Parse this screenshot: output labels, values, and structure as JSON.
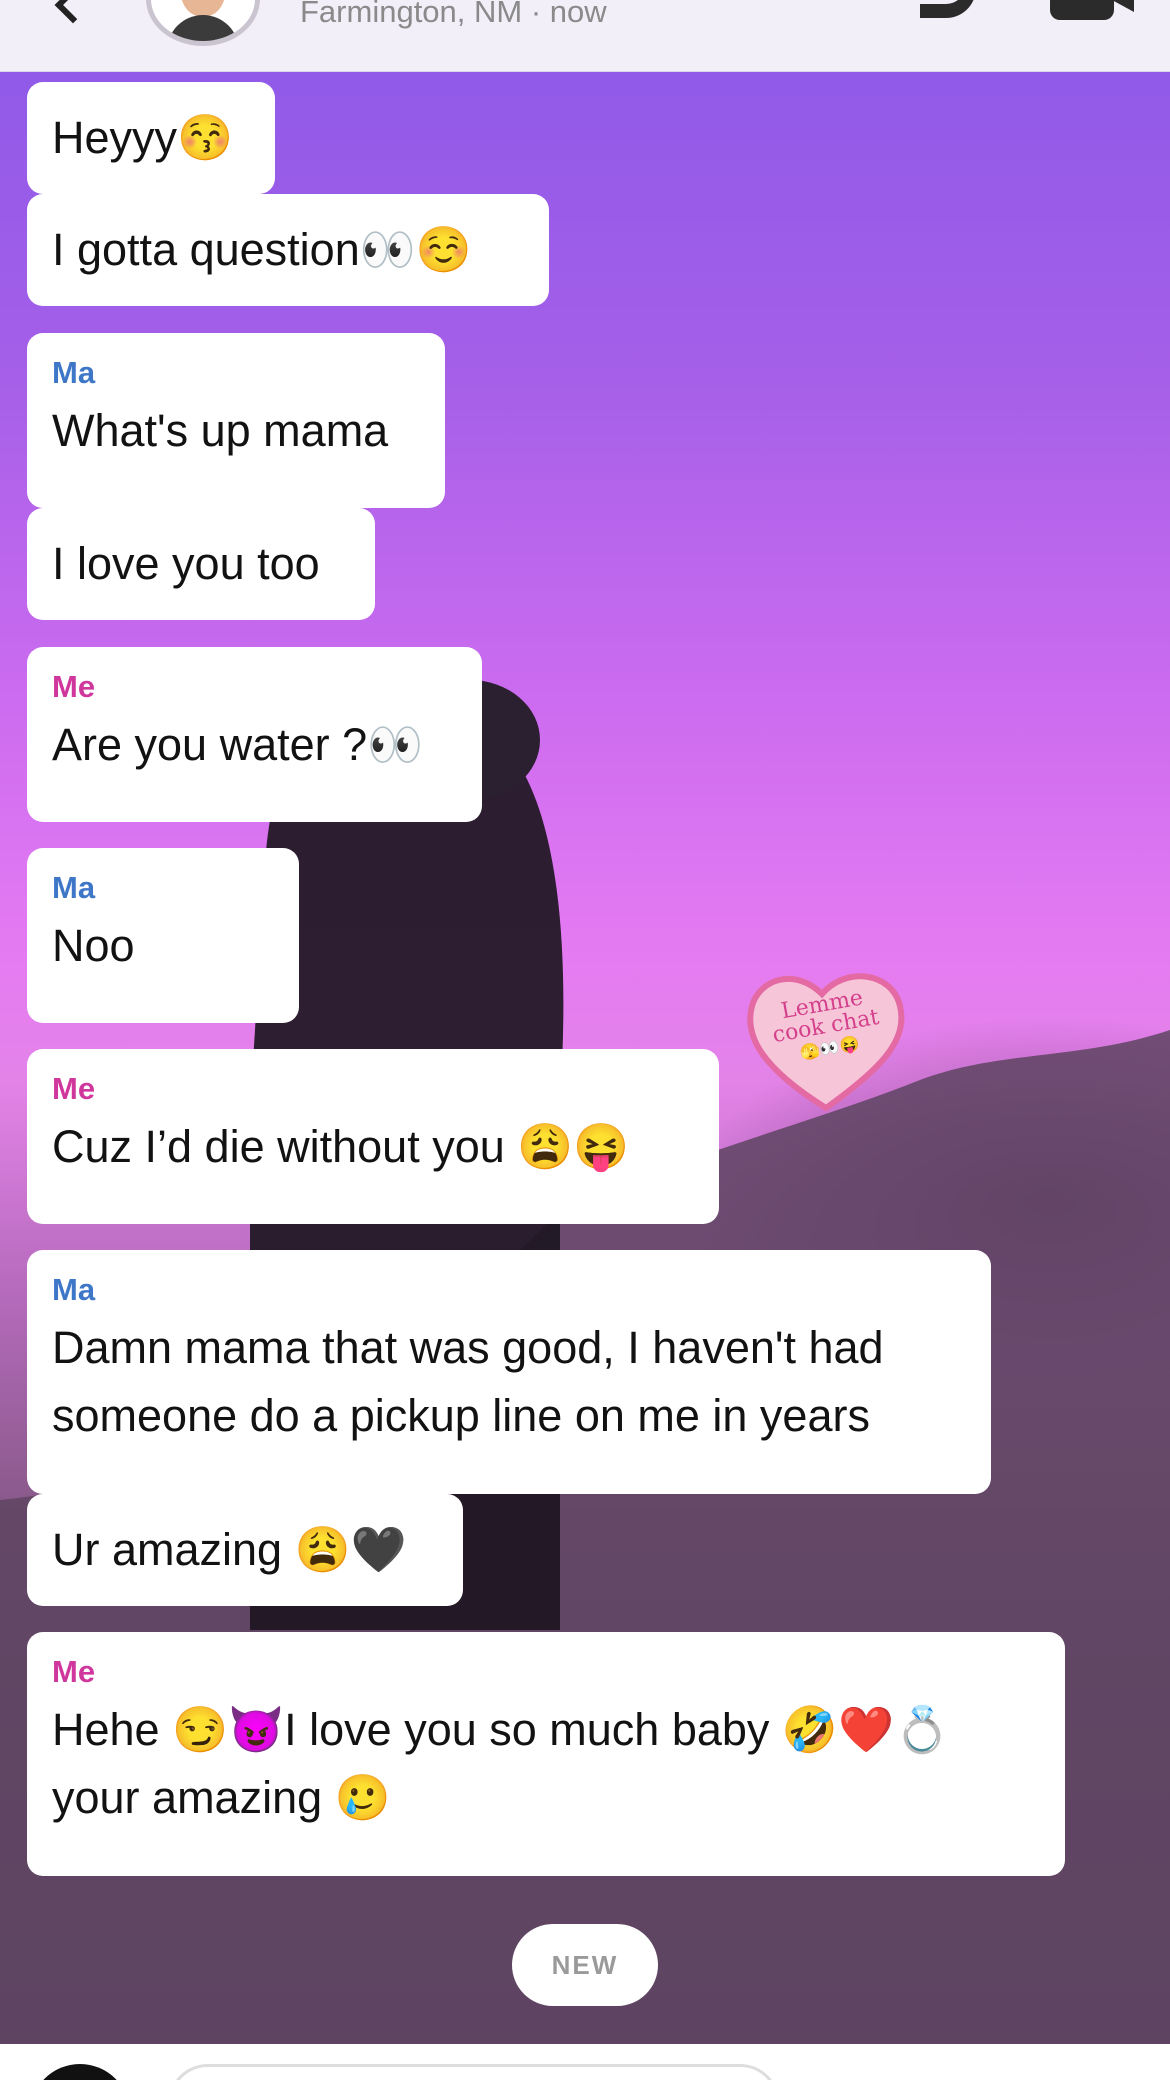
{
  "header": {
    "subtitle": "Farmington, NM · now"
  },
  "messages": [
    {
      "sender": "",
      "text": "Heyyy😚"
    },
    {
      "sender": "",
      "text": "I gotta question👀☺️"
    },
    {
      "sender": "Ma",
      "text": "What's up mama"
    },
    {
      "sender": "",
      "text": "I love you too"
    },
    {
      "sender": "Me",
      "text": "Are you water ?👀"
    },
    {
      "sender": "Ma",
      "text": "Noo"
    },
    {
      "sender": "Me",
      "text": "Cuz I’d die without you 😩😝"
    },
    {
      "sender": "Ma",
      "text": "Damn mama that was good, I haven't had someone do a pickup line on me in years"
    },
    {
      "sender": "",
      "text": "Ur amazing 😩🖤"
    },
    {
      "sender": "Me",
      "text": "Hehe 😏😈I love you so much baby 🤣❤️💍 your amazing 🥲"
    }
  ],
  "sticker": {
    "line1": "Lemme",
    "line2": "cook chat",
    "line3": "🫣👀😝"
  },
  "new_label": "NEW",
  "colors": {
    "ma_accent": "#3f77c8",
    "me_accent": "#d0379c"
  }
}
